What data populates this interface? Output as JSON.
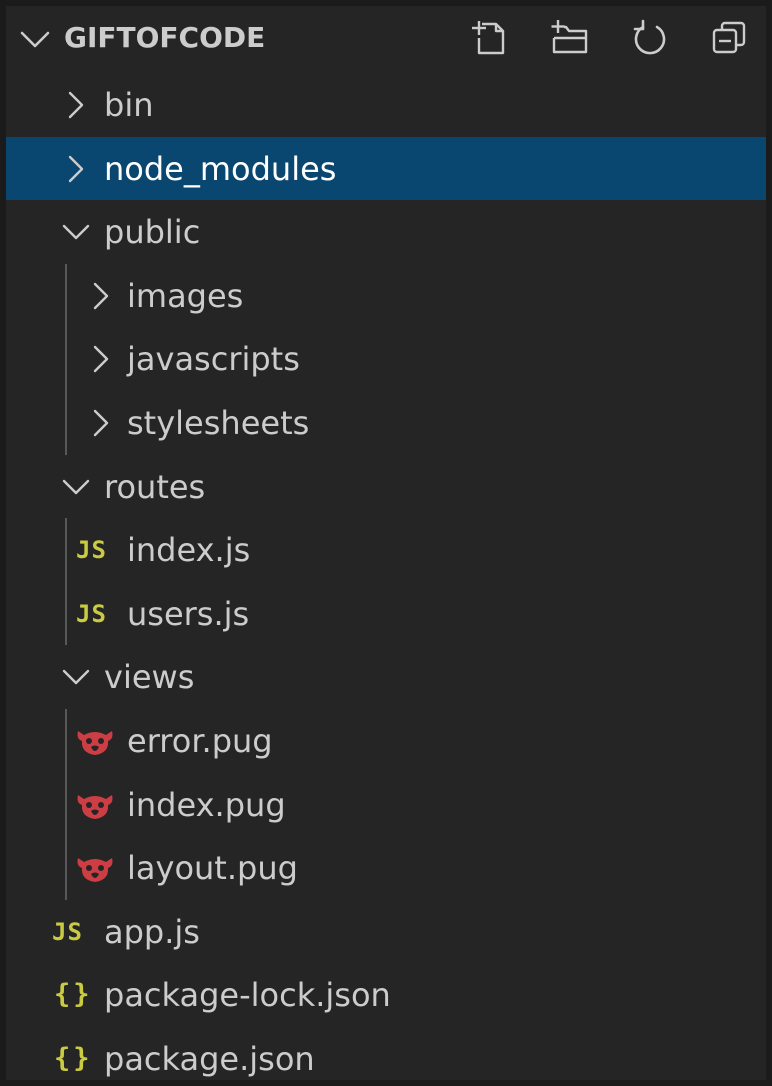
{
  "explorer": {
    "title": "GIFTOFCODE",
    "actions": [
      {
        "name": "new-file-icon",
        "label": "New File"
      },
      {
        "name": "new-folder-icon",
        "label": "New Folder"
      },
      {
        "name": "refresh-icon",
        "label": "Refresh Explorer"
      },
      {
        "name": "collapse-all-icon",
        "label": "Collapse Folders in Explorer"
      }
    ]
  },
  "tree": {
    "items": [
      {
        "label": "bin",
        "type": "folder",
        "expanded": false,
        "depth": 1
      },
      {
        "label": "node_modules",
        "type": "folder",
        "expanded": false,
        "depth": 1,
        "selected": true
      },
      {
        "label": "public",
        "type": "folder",
        "expanded": true,
        "depth": 1
      },
      {
        "label": "images",
        "type": "folder",
        "expanded": false,
        "depth": 2
      },
      {
        "label": "javascripts",
        "type": "folder",
        "expanded": false,
        "depth": 2
      },
      {
        "label": "stylesheets",
        "type": "folder",
        "expanded": false,
        "depth": 2
      },
      {
        "label": "routes",
        "type": "folder",
        "expanded": true,
        "depth": 1
      },
      {
        "label": "index.js",
        "type": "js",
        "depth": 2
      },
      {
        "label": "users.js",
        "type": "js",
        "depth": 2
      },
      {
        "label": "views",
        "type": "folder",
        "expanded": true,
        "depth": 1
      },
      {
        "label": "error.pug",
        "type": "pug",
        "depth": 2
      },
      {
        "label": "index.pug",
        "type": "pug",
        "depth": 2
      },
      {
        "label": "layout.pug",
        "type": "pug",
        "depth": 2
      },
      {
        "label": "app.js",
        "type": "js",
        "depth": 1
      },
      {
        "label": "package-lock.json",
        "type": "json",
        "depth": 1
      },
      {
        "label": "package.json",
        "type": "json",
        "depth": 1
      }
    ]
  },
  "icons": {
    "js_glyph": "JS",
    "json_glyph": "{}"
  },
  "colors": {
    "background": "#252526",
    "selection": "#094771",
    "text": "#cccccc",
    "js_icon": "#cbcb41",
    "pug_icon": "#cc3e44"
  }
}
